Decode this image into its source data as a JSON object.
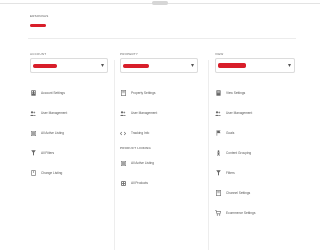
{
  "header": {
    "title": "ERSONNAS",
    "accent_color": "#d81e2a"
  },
  "columns": [
    {
      "label": "ACCOUNT",
      "select": {
        "value": "",
        "caret": "▾"
      },
      "items": [
        {
          "label": "Account Settings",
          "icon": "building-icon"
        },
        {
          "label": "User Management",
          "icon": "users-icon"
        },
        {
          "label": "All Active Listing",
          "icon": "listing-icon"
        },
        {
          "label": "All Filters",
          "icon": "filter-icon"
        },
        {
          "label": "Change Listing",
          "icon": "tag-icon"
        }
      ]
    },
    {
      "label": "PROPERTY",
      "select": {
        "value": "",
        "caret": "▾"
      },
      "items": [
        {
          "label": "Property Settings",
          "icon": "document-icon"
        },
        {
          "label": "User Management",
          "icon": "users-icon"
        },
        {
          "label": "Tracking Info",
          "icon": "code-icon"
        }
      ],
      "section": {
        "heading": "PRODUCT LINKING",
        "items": [
          {
            "label": "All Active Listing",
            "icon": "listing-icon"
          },
          {
            "label": "All Products",
            "icon": "grid-icon"
          }
        ]
      }
    },
    {
      "label": "VIEW",
      "select": {
        "value": "",
        "caret": "▾"
      },
      "items": [
        {
          "label": "View Settings",
          "icon": "document-icon"
        },
        {
          "label": "User Management",
          "icon": "users-icon"
        },
        {
          "label": "Goals",
          "icon": "flag-icon"
        },
        {
          "label": "Content Grouping",
          "icon": "person-icon"
        },
        {
          "label": "Filters",
          "icon": "filter-icon"
        },
        {
          "label": "Channel Settings",
          "icon": "document-icon"
        },
        {
          "label": "Ecommerce Settings",
          "icon": "cart-icon"
        }
      ]
    }
  ]
}
